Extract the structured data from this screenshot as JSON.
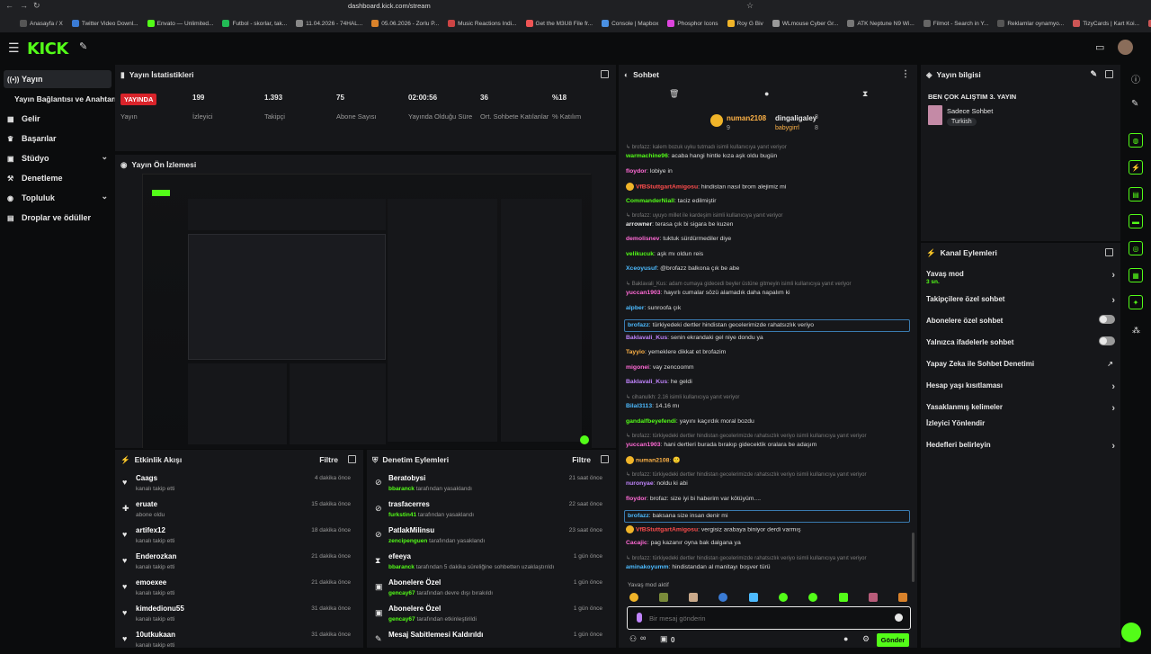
{
  "browser": {
    "url": "dashboard.kick.com/stream",
    "bookmarks": [
      "Anasayfa / X",
      "Twitter Video Downl...",
      "Envato — Unlimited...",
      "Futbol - skorlar, tak...",
      "11.04.2026 - 74HAL...",
      "05.06.2026 - Zorlu P...",
      "Music Reactions Indi...",
      "Get the M3U8 File fr...",
      "Console | Mapbox",
      "Phosphor Icons",
      "Roy G Biv",
      "WLmouse Cyber Gr...",
      "ATK Neptune N9 Wi...",
      "Filmot - Search in Y...",
      "Reklamlar oynamyo...",
      "TizyCards | Kart Koi...",
      "TizyCards | Kart Koi..."
    ]
  },
  "header": {
    "logo": "KICK"
  },
  "sidebar": {
    "items": [
      {
        "label": "Yayın",
        "icon": "broadcast-icon"
      },
      {
        "label": "Yayın Bağlantısı ve Anahtarı",
        "icon": ""
      },
      {
        "label": "Gelir",
        "icon": "revenue-icon"
      },
      {
        "label": "Başarılar",
        "icon": "trophy-icon"
      },
      {
        "label": "Stüdyo",
        "icon": "studio-icon"
      },
      {
        "label": "Denetleme",
        "icon": "hammer-icon"
      },
      {
        "label": "Topluluk",
        "icon": "community-icon"
      },
      {
        "label": "Droplar ve ödüller",
        "icon": "gift-icon"
      }
    ]
  },
  "stats": {
    "title": "Yayın İstatistikleri",
    "live_badge": "YAYINDA",
    "live_label": "Yayın",
    "items": [
      {
        "value": "199",
        "label": "İzleyici"
      },
      {
        "value": "1.393",
        "label": "Takipçi"
      },
      {
        "value": "75",
        "label": "Abone Sayısı"
      },
      {
        "value": "02:00:56",
        "label": "Yayında Olduğu Süre"
      },
      {
        "value": "36",
        "label": "Ort. Sohbete Katılanlar"
      },
      {
        "value": "%18",
        "label": "% Katılım"
      }
    ]
  },
  "preview": {
    "title": "Yayın Ön İzlemesi"
  },
  "activity": {
    "title": "Etkinlik Akışı",
    "filter": "Filtre",
    "rows": [
      {
        "name": "Caags",
        "sub": "kanalı takip etti",
        "time": "4 dakika önce",
        "icon": "heart-icon"
      },
      {
        "name": "eruate",
        "sub": "abone oldu",
        "time": "15 dakika önce",
        "icon": "star-icon"
      },
      {
        "name": "artifex12",
        "sub": "kanalı takip etti",
        "time": "18 dakika önce",
        "icon": "heart-icon"
      },
      {
        "name": "Enderozkan",
        "sub": "kanalı takip etti",
        "time": "21 dakika önce",
        "icon": "heart-icon"
      },
      {
        "name": "emoexee",
        "sub": "kanalı takip etti",
        "time": "21 dakika önce",
        "icon": "heart-icon"
      },
      {
        "name": "kimdedionu55",
        "sub": "kanalı takip etti",
        "time": "31 dakika önce",
        "icon": "heart-icon"
      },
      {
        "name": "10utkukaan",
        "sub": "kanalı takip etti",
        "time": "31 dakika önce",
        "icon": "heart-icon"
      }
    ]
  },
  "moderation": {
    "title": "Denetim Eylemleri",
    "filter": "Filtre",
    "rows": [
      {
        "name": "Beratobysi",
        "mod": "bbaranck",
        "action": "tarafından yasaklandı",
        "time": "21 saat önce",
        "icon": "ban-icon"
      },
      {
        "name": "trasfacerres",
        "mod": "furkstin41",
        "action": "tarafından yasaklandı",
        "time": "22 saat önce",
        "icon": "ban-icon"
      },
      {
        "name": "PatlakMilinsu",
        "mod": "zencipenguen",
        "action": "tarafından yasaklandı",
        "time": "23 saat önce",
        "icon": "ban-icon"
      },
      {
        "name": "efeeya",
        "mod": "bbaranck",
        "action": "tarafından 5 dakika süreliğine sohbetten uzaklaştırıldı",
        "time": "1 gün önce",
        "icon": "hourglass-icon"
      },
      {
        "name": "Abonelere Özel",
        "mod": "gencay67",
        "action": "tarafından devre dışı bırakıldı",
        "time": "1 gün önce",
        "icon": "subscriber-icon"
      },
      {
        "name": "Abonelere Özel",
        "mod": "gencay67",
        "action": "tarafından etkinleştirildi",
        "time": "1 gün önce",
        "icon": "subscriber-icon"
      },
      {
        "name": "Mesaj Sabitlemesi Kaldırıldı",
        "mod": "",
        "action": "",
        "time": "1 gün önce",
        "icon": "pin-icon"
      }
    ]
  },
  "chat": {
    "title": "Sohbet",
    "top_users": [
      {
        "name": "numan2108",
        "count": "9"
      },
      {
        "name": "dingaligaley",
        "count": "8"
      },
      {
        "name": "babygirrl",
        "count": "8"
      }
    ],
    "messages": [
      {
        "user": "brofazz: kalem bozuk uyku tutmadı isimli kullanıcıya yanıt veriyor",
        "text": "",
        "color": "#7b7b7b",
        "reply": true
      },
      {
        "user": "warmachine96",
        "text": "acaba hangi hintle kıza aşk oldu bugün",
        "color": "#53fc18"
      },
      {
        "user": "floydor",
        "text": "lobiye in",
        "color": "#ff6ad5"
      },
      {
        "user": "VfBStuttgartAmigosu",
        "text": "hindistan nasıl brom alejimiz mi",
        "color": "#ff4d4d"
      },
      {
        "user": "CommanderNiall",
        "text": "taciz edilmiştir",
        "color": "#53fc18"
      },
      {
        "user": "brofazz: uyuyo millet ile kardeşim isimli kullanıcıya yanıt veriyor",
        "text": "",
        "color": "#7b7b7b",
        "reply": true
      },
      {
        "user": "arrowner",
        "text": "terasa çık bi sigara be kuzen",
        "color": "#e8e8e8"
      },
      {
        "user": "demolisnev",
        "text": "tuktuk sürdürmediler diye",
        "color": "#ff6ad5"
      },
      {
        "user": "velikucuk",
        "text": "aşk mı oldun reis",
        "color": "#53fc18"
      },
      {
        "user": "Xceoyusuf",
        "text": "@brofazz balkona çık be abe",
        "color": "#4dbbff"
      },
      {
        "user": "Baklavali_Kus: adam cumaya gidecedi beyler üstüne gitmeyin isimli kullanıcıya yanıt veriyor",
        "text": "",
        "color": "#7b7b7b",
        "reply": true
      },
      {
        "user": "yuccan1903",
        "text": "hayırlı cumalar sözü alamadık daha napalım ki",
        "color": "#ff6ad5"
      },
      {
        "user": "alpber",
        "text": "sunroofa çık",
        "color": "#4dbbff"
      },
      {
        "user": "brofazz",
        "text": "türkiyedeki dertler hindistan gecelerimizde rahatsızlık veriyo",
        "color": "#4dbbff",
        "highlight": true
      },
      {
        "user": "Baklavali_Kus",
        "text": "senin ekrandaki gel niye dondu ya",
        "color": "#c084fc"
      },
      {
        "user": "Tayyio",
        "text": "yemeklere dikkat et brofazim",
        "color": "#ffb347"
      },
      {
        "user": "migonei",
        "text": "vay zencoomm",
        "color": "#ff6ad5"
      },
      {
        "user": "Baklavali_Kus",
        "text": "he geldi",
        "color": "#c084fc"
      },
      {
        "user": "cihanulkh: 2.16 isimli kullanıcıya yanıt veriyor",
        "text": "",
        "color": "#7b7b7b",
        "reply": true
      },
      {
        "user": "Bilal3113",
        "text": "14.16 mı",
        "color": "#4dbbff"
      },
      {
        "user": "gandalfbeyefendi",
        "text": "yayını kaçırdık moral bozdu",
        "color": "#53fc18"
      },
      {
        "user": "brofazz: türkiyedeki dertler hindistan gecelerimizde rahatsızlık veriyo isimli kullanıcıya yanıt veriyor",
        "text": "",
        "color": "#7b7b7b",
        "reply": true
      },
      {
        "user": "yuccan1903",
        "text": "hani dertleri burada bırakıp gidecektik oralara be adaşım",
        "color": "#ff6ad5"
      },
      {
        "user": "numan2108",
        "text": "🙂",
        "color": "#ffb347"
      },
      {
        "user": "brofazz: türkiyedeki dertler hindistan gecelerimizde rahatsızlık veriyo isimli kullanıcıya yanıt veriyor",
        "text": "",
        "color": "#7b7b7b",
        "reply": true
      },
      {
        "user": "nuronyae",
        "text": "noldu ki abi",
        "color": "#c084fc"
      },
      {
        "user": "floydor",
        "text": "brofaz: size iyi bi haberim var kötüyüm....",
        "color": "#ff6ad5"
      },
      {
        "user": "brofazz",
        "text": "baksana size insan denir mi",
        "color": "#4dbbff",
        "highlight": true
      },
      {
        "user": "VfBStuttgartAmigosu",
        "text": "vergisiz arabaya biniyor derdi varmış",
        "color": "#ff4d4d"
      },
      {
        "user": "Cacajic",
        "text": "pag kazanır oyna bak dalgana ya",
        "color": "#ff6ad5"
      },
      {
        "user": "brofazz: türkiyedeki dertler hindistan gecelerimizde rahatsızlık veriyo isimli kullanıcıya yanıt veriyor",
        "text": "",
        "color": "#7b7b7b",
        "reply": true
      },
      {
        "user": "aminakoyumm",
        "text": "hindistandan al manitayı boşver türü",
        "color": "#4dbbff"
      }
    ],
    "slow_mode": "Yavaş mod aktif",
    "input_placeholder": "Bir mesaj gönderin",
    "send_label": "Gönder",
    "points": "0",
    "viewers_icon": "∞"
  },
  "stream_info": {
    "title": "Yayın bilgisi",
    "stream_title": "BEN ÇOK ALIŞTIM 3. YAYIN",
    "category": "Sadece Sohbet",
    "language": "Turkish"
  },
  "channel_actions": {
    "title": "Kanal Eylemleri",
    "items": [
      {
        "label": "Yavaş mod",
        "sub": "3 sn.",
        "control": "chevron"
      },
      {
        "label": "Takipçilere özel sohbet",
        "sub": "",
        "control": "chevron"
      },
      {
        "label": "Abonelere özel sohbet",
        "sub": "",
        "control": "toggle"
      },
      {
        "label": "Yalnızca ifadelerle sohbet",
        "sub": "",
        "control": "toggle"
      },
      {
        "label": "Yapay Zeka ile Sohbet Denetimi",
        "sub": "",
        "control": "external"
      },
      {
        "label": "Hesap yaşı kısıtlaması",
        "sub": "",
        "control": "chevron"
      },
      {
        "label": "Yasaklanmış kelimeler",
        "sub": "",
        "control": "chevron"
      },
      {
        "label": "İzleyici Yönlendir",
        "sub": "",
        "control": "none"
      },
      {
        "label": "Hedefleri belirleyin",
        "sub": "",
        "control": "chevron"
      }
    ]
  },
  "colors": {
    "accent": "#53fc18",
    "live": "#d9232a",
    "panel": "#16171a",
    "bg": "#0b0c0d"
  }
}
